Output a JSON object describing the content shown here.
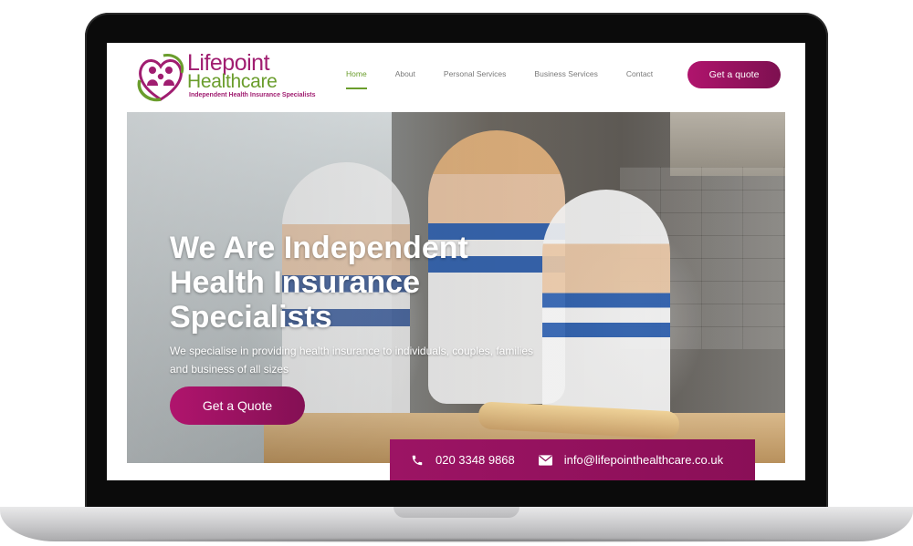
{
  "brand": {
    "name_line1": "Lifepoint",
    "name_line2": "Healthcare",
    "tagline": "Independent Health Insurance Specialists",
    "colors": {
      "magenta": "#a01d70",
      "green": "#6a9d2c"
    }
  },
  "nav": {
    "items": [
      {
        "label": "Home",
        "active": true
      },
      {
        "label": "About",
        "active": false
      },
      {
        "label": "Personal Services",
        "active": false
      },
      {
        "label": "Business Services",
        "active": false
      },
      {
        "label": "Contact",
        "active": false
      }
    ]
  },
  "header": {
    "quote_button": "Get a quote"
  },
  "hero": {
    "title": "We Are Independent Health Insurance Specialists",
    "subtitle": "We specialise in providing health insurance to individuals, couples, families and business of all sizes",
    "cta": "Get a Quote"
  },
  "contact": {
    "phone": "020 3348 9868",
    "email": "info@lifepointhealthcare.co.uk",
    "phone_icon": "phone-icon",
    "email_icon": "envelope-icon"
  }
}
